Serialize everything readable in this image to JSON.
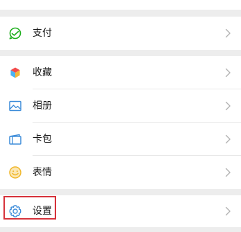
{
  "menu": {
    "pay": {
      "label": "支付",
      "icon": "pay-icon"
    },
    "favorites": {
      "label": "收藏",
      "icon": "favorites-cube-icon"
    },
    "album": {
      "label": "相册",
      "icon": "photo-icon"
    },
    "cards": {
      "label": "卡包",
      "icon": "card-wallet-icon"
    },
    "stickers": {
      "label": "表情",
      "icon": "smiley-icon"
    },
    "settings": {
      "label": "设置",
      "icon": "gear-icon"
    }
  },
  "colors": {
    "background": "#ededed",
    "row": "#ffffff",
    "pay_green": "#1aad19",
    "album_blue": "#3b8bd9",
    "stickers_yellow": "#f0b628",
    "highlight_red": "#d6313a"
  }
}
